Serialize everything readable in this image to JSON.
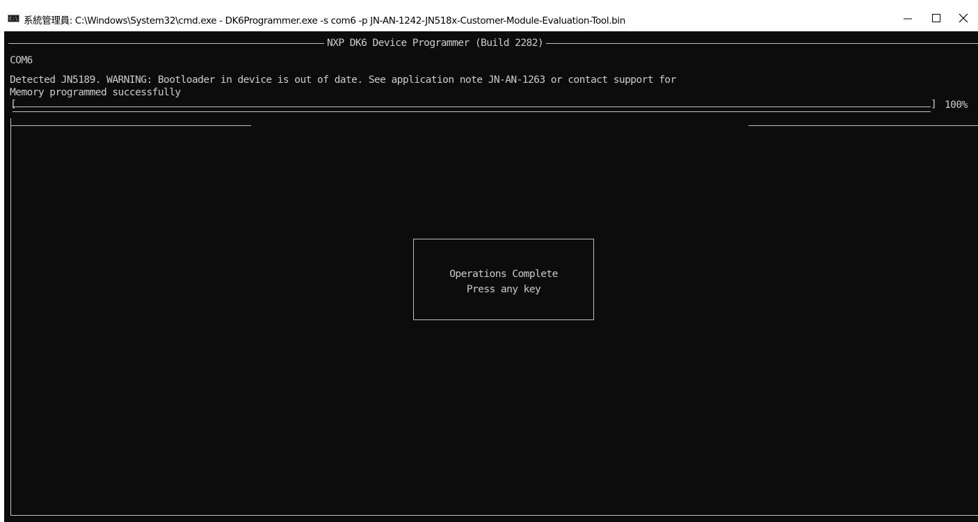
{
  "window": {
    "icon_label": "C:\\",
    "title": "系統管理員: C:\\Windows\\System32\\cmd.exe - DK6Programmer.exe  -s com6 -p JN-AN-1242-JN518x-Customer-Module-Evaluation-Tool.bin",
    "minimize_icon": "minimize-icon",
    "maximize_icon": "maximize-icon",
    "close_icon": "close-icon"
  },
  "console": {
    "banner": "NXP DK6 Device Programmer (Build 2282)",
    "lines": [
      "COM6",
      "Detected JN5189. WARNING: Bootloader in device is out of date. See application note JN-AN-1263 or contact support for",
      "Memory programmed successfully"
    ],
    "progress": {
      "open_bracket": "[",
      "close_bracket": "]",
      "percent_label": "100%",
      "value": 1.0
    },
    "dialog": {
      "line1": "Operations Complete",
      "line2": "Press any key"
    },
    "colors": {
      "background": "#0c0c0c",
      "foreground": "#cccccc"
    }
  }
}
